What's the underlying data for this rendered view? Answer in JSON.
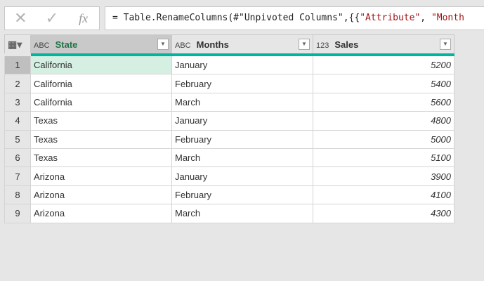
{
  "formula_bar": {
    "cancel_icon": "✕",
    "confirm_icon": "✓",
    "fx_label": "fx",
    "formula_prefix": "= Table.RenameColumns(#\"Unpivoted Columns\",{{",
    "formula_str1": "\"Attribute\"",
    "formula_sep": ", ",
    "formula_str2": "\"Month"
  },
  "table": {
    "columns": [
      {
        "type": "ABC",
        "label": "State"
      },
      {
        "type": "ABC",
        "label": "Months"
      },
      {
        "type": "123",
        "label": "Sales"
      }
    ],
    "rows": [
      [
        "1",
        "California",
        "January",
        "5200"
      ],
      [
        "2",
        "California",
        "February",
        "5400"
      ],
      [
        "3",
        "California",
        "March",
        "5600"
      ],
      [
        "4",
        "Texas",
        "January",
        "4800"
      ],
      [
        "5",
        "Texas",
        "February",
        "5000"
      ],
      [
        "6",
        "Texas",
        "March",
        "5100"
      ],
      [
        "7",
        "Arizona",
        "January",
        "3900"
      ],
      [
        "8",
        "Arizona",
        "February",
        "4100"
      ],
      [
        "9",
        "Arizona",
        "March",
        "4300"
      ]
    ]
  }
}
